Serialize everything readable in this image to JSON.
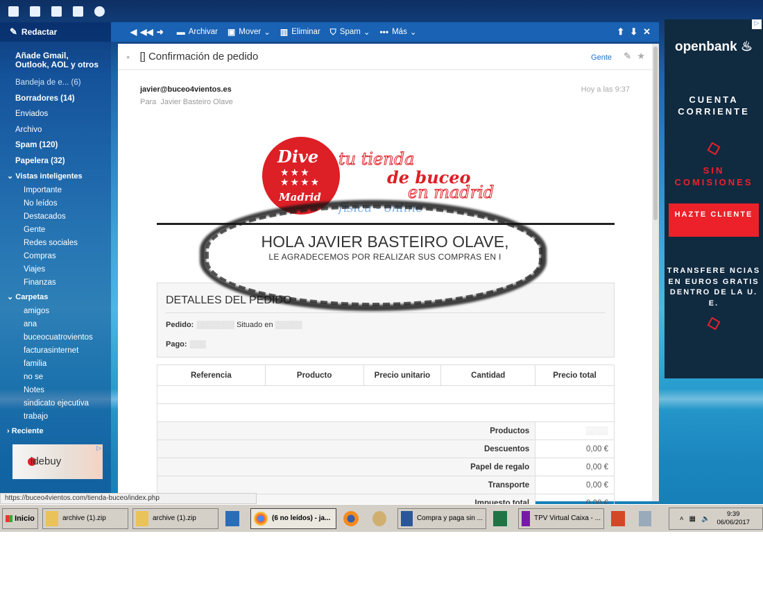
{
  "top_bar": {
    "icons": [
      "mail-icon",
      "contacts-icon",
      "calendar-icon",
      "notepad-icon",
      "messenger-icon"
    ]
  },
  "sidebar": {
    "compose": "Redactar",
    "promo": "Añade Gmail, Outlook, AOL y otros",
    "folders": [
      {
        "label": "Bandeja de e... (6)",
        "bold": false
      },
      {
        "label": "Borradores (14)",
        "bold": true
      },
      {
        "label": "Enviados",
        "bold": false
      },
      {
        "label": "Archivo",
        "bold": false
      },
      {
        "label": "Spam (120)",
        "bold": true
      },
      {
        "label": "Papelera (32)",
        "bold": true
      }
    ],
    "smart_header": "Vistas inteligentes",
    "smart": [
      "Importante",
      "No leídos",
      "Destacados",
      "Gente",
      "Redes sociales",
      "Compras",
      "Viajes",
      "Finanzas"
    ],
    "folders_header": "Carpetas",
    "custom": [
      "amigos",
      "ana",
      "buceocuatrovientos",
      "facturasinternet",
      "familia",
      "no se",
      "Notes",
      "sindicato ejecutiva",
      "trabajo"
    ],
    "recent_header": "Reciente",
    "ad_text": "idebuy"
  },
  "toolbar": {
    "archive": "Archivar",
    "move": "Mover",
    "delete": "Eliminar",
    "spam": "Spam",
    "more": "Más"
  },
  "message": {
    "subject": "[] Confirmación de pedido",
    "people": "Gente",
    "from": "javier@buceo4vientos.es",
    "to_label": "Para",
    "to_name": "Javier Basteiro Olave",
    "time": "Hoy a las 9:37",
    "logo": {
      "dive": "Dive",
      "madrid": "Madrid",
      "l1": "tu tienda",
      "l2": "de buceo",
      "l3": "en madrid",
      "l4": "física - online"
    },
    "greeting": "HOLA JAVIER BASTEIRO OLAVE,",
    "thanks": "LE AGRADECEMOS POR REALIZAR SUS COMPRAS EN I",
    "details_title": "DETALLES DEL PEDIDO",
    "order_label": "Pedido:",
    "order_tail": "Situado en",
    "payment_label": "Pago:",
    "columns": [
      "Referencia",
      "Producto",
      "Precio unitario",
      "Cantidad",
      "Precio total"
    ],
    "totals": [
      {
        "label": "Productos",
        "value": ""
      },
      {
        "label": "Descuentos",
        "value": "0,00 €"
      },
      {
        "label": "Papel de regalo",
        "value": "0,00 €"
      },
      {
        "label": "Transporte",
        "value": "0,00 €"
      },
      {
        "label": "Impuesto total",
        "value": "0,00 €"
      }
    ]
  },
  "ad": {
    "brand": "openbank",
    "line1": "CUENTA CORRIENTE",
    "line2": "SIN COMISIONES",
    "cta": "HAZTE CLIENTE",
    "line3": "TRANSFERE NCIAS EN EUROS GRATIS DENTRO DE LA U. E."
  },
  "status_url": "https://buceo4vientos.com/tienda-buceo/index.php",
  "taskbar": {
    "start": "Inicio",
    "items": [
      "archive (1).zip",
      "archive (1).zip",
      "(6 no leídos) - ja...",
      "Compra y paga sin ...",
      "TPV Virtual Caixa - ..."
    ],
    "time": "9:39",
    "date": "06/06/2017"
  },
  "colors": {
    "toolbar": "#1962b4",
    "ad_red": "#ec2129",
    "ad_bg": "#102a40",
    "logo_red": "#dd1f26"
  }
}
